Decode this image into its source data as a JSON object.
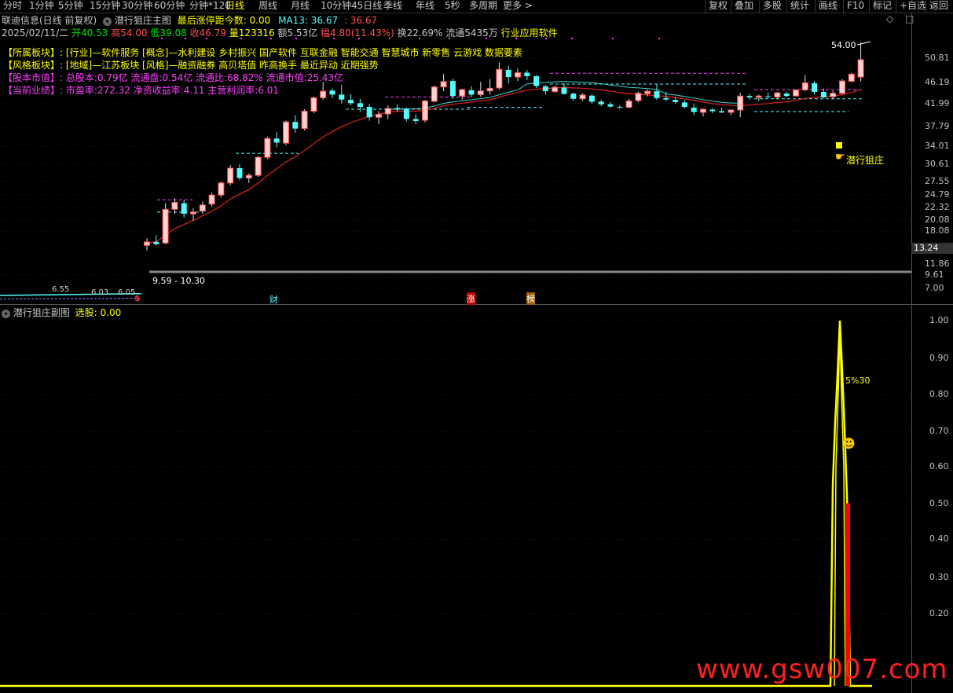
{
  "toolbar": {
    "periods": [
      "分时",
      "1分钟",
      "5分钟",
      "15分钟",
      "30分钟",
      "60分钟",
      "分钟*120",
      "日线",
      "周线",
      "月线",
      "10分钟",
      "45日线",
      "季线",
      "年线",
      "5秒",
      "多周期",
      "更多 >"
    ],
    "active_index": 7,
    "right_buttons": [
      "复权",
      "叠加",
      "多股",
      "统计",
      "画线",
      "F10",
      "标记",
      "+自选",
      "返回"
    ]
  },
  "stock": {
    "title": "联迪信息(日线 前复权)",
    "indicator": "潜行狙庄主图",
    "limit_text": "最后涨停距今数: 0.00",
    "ma13_label": "MA13: 36.67",
    "ma13_extra": ": 36.67"
  },
  "quote": {
    "date": "2025/02/11/二",
    "open": "开40.53",
    "high": "高54.00",
    "low": "低39.08",
    "close": "收46.79",
    "volume": "量123316",
    "amount": "额5.53亿",
    "change": "幅4.80(11.43%)",
    "turnover": "换22.69%",
    "float": "流通5435万",
    "industry": "行业应用软件"
  },
  "info": {
    "sector_label": "【所属板块】:",
    "sector_value": "[行业]—软件服务 [概念]—水利建设 乡村振兴 国产软件 互联金融 智能交通 智慧城市 新零售 云游戏 数据要素",
    "style_label": "【风格板块】:",
    "style_value": "[地域]—江苏板块 [风格]—融资融券 高贝塔值 昨高换手 最近异动 近期强势",
    "capital_label": "【股本市值】:",
    "capital_value": "总股本:0.79亿 流通盘:0.54亿 流通比:68.82% 流通市值:25.43亿",
    "perf_label": "【当前业绩】:",
    "perf_value": "市盈率:272.32 净资收益率:4.11 主营利润率:6.01"
  },
  "main_chart": {
    "y_ticks": [
      "50.81",
      "46.19",
      "41.99",
      "37.79",
      "34.01",
      "30.61",
      "27.55",
      "24.79",
      "22.32",
      "20.08",
      "18.08",
      "13.24",
      "11.86",
      "9.61",
      "7.00"
    ],
    "high_annotation": "54.00",
    "range_annotation": "9.59 - 10.30",
    "low_annotations": [
      "6.55",
      "6.03",
      "6.05"
    ],
    "signal_label": "潜行狙庄",
    "event_markers": [
      "$",
      "财",
      "涨",
      "榜"
    ],
    "current_price_box": "13.24"
  },
  "sub_chart": {
    "title": "潜行狙庄副图",
    "select_text": "选股: 0.00",
    "y_ticks": [
      "1.00",
      "0.90",
      "0.80",
      "0.70",
      "0.60",
      "0.50",
      "0.40",
      "0.30",
      "0.20"
    ],
    "peak_label": "5%30",
    "smiley": "☻"
  },
  "watermark": "www.gsw007.com",
  "colors": {
    "up": "#ff5050",
    "down": "#54fcfc",
    "ma": "#e02020",
    "ma2": "#40d0d0",
    "yellow": "#ffff00",
    "magenta": "#ff40ff",
    "bg": "#000000"
  },
  "chart_data": {
    "type": "candlestick",
    "candles": [
      [
        10.0,
        10.6,
        9.6,
        10.3
      ],
      [
        10.3,
        10.9,
        10.0,
        10.1
      ],
      [
        10.2,
        14.2,
        10.1,
        13.5
      ],
      [
        13.5,
        14.8,
        13.0,
        14.3
      ],
      [
        14.2,
        14.6,
        12.6,
        13.0
      ],
      [
        13.0,
        13.6,
        12.3,
        13.2
      ],
      [
        13.3,
        14.4,
        13.0,
        14.0
      ],
      [
        14.1,
        15.5,
        13.8,
        15.2
      ],
      [
        15.2,
        17.0,
        14.9,
        16.8
      ],
      [
        16.8,
        19.5,
        16.5,
        19.0
      ],
      [
        19.0,
        19.6,
        17.2,
        17.5
      ],
      [
        17.5,
        18.2,
        16.8,
        17.9
      ],
      [
        17.9,
        21.0,
        17.7,
        20.8
      ],
      [
        20.8,
        24.7,
        20.5,
        24.3
      ],
      [
        24.3,
        25.6,
        22.6,
        23.5
      ],
      [
        23.4,
        28.2,
        23.0,
        27.9
      ],
      [
        27.9,
        29.5,
        25.5,
        26.4
      ],
      [
        26.4,
        31.0,
        26.0,
        30.5
      ],
      [
        30.5,
        34.5,
        30.0,
        34.1
      ],
      [
        34.1,
        38.9,
        33.5,
        36.0
      ],
      [
        36.2,
        36.8,
        34.0,
        35.0
      ],
      [
        35.0,
        37.9,
        32.5,
        33.6
      ],
      [
        33.5,
        35.2,
        32.0,
        32.6
      ],
      [
        32.6,
        33.8,
        30.4,
        31.6
      ],
      [
        31.6,
        32.4,
        28.2,
        29.0
      ],
      [
        29.0,
        30.5,
        27.4,
        29.7
      ],
      [
        29.8,
        32.0,
        28.6,
        31.2
      ],
      [
        31.3,
        32.3,
        30.3,
        30.9
      ],
      [
        31.0,
        31.4,
        28.0,
        28.6
      ],
      [
        28.6,
        29.8,
        27.4,
        28.1
      ],
      [
        28.3,
        33.5,
        27.8,
        33.2
      ],
      [
        33.1,
        37.8,
        32.8,
        37.3
      ],
      [
        37.3,
        41.5,
        36.0,
        39.0
      ],
      [
        39.2,
        40.0,
        33.8,
        34.6
      ],
      [
        34.6,
        36.8,
        33.6,
        36.5
      ],
      [
        36.3,
        37.5,
        34.2,
        35.0
      ],
      [
        35.0,
        38.9,
        34.4,
        36.1
      ],
      [
        36.1,
        39.8,
        35.0,
        36.9
      ],
      [
        37.0,
        45.8,
        36.5,
        43.2
      ],
      [
        43.0,
        44.5,
        38.4,
        40.5
      ],
      [
        40.5,
        43.5,
        39.2,
        42.0
      ],
      [
        42.0,
        43.0,
        39.5,
        40.8
      ],
      [
        40.8,
        41.2,
        37.0,
        37.6
      ],
      [
        37.5,
        38.0,
        35.0,
        36.0
      ],
      [
        35.9,
        37.7,
        35.5,
        37.2
      ],
      [
        37.1,
        38.5,
        35.0,
        35.2
      ],
      [
        35.3,
        35.6,
        33.2,
        33.8
      ],
      [
        33.8,
        35.4,
        33.2,
        34.9
      ],
      [
        34.7,
        35.2,
        32.5,
        33.0
      ],
      [
        33.0,
        33.6,
        31.8,
        32.3
      ],
      [
        32.3,
        32.9,
        31.3,
        31.7
      ],
      [
        31.6,
        32.0,
        31.2,
        31.5
      ],
      [
        31.5,
        33.8,
        31.2,
        33.2
      ],
      [
        33.3,
        35.9,
        32.8,
        35.4
      ],
      [
        35.3,
        36.5,
        34.5,
        36.0
      ],
      [
        36.0,
        38.2,
        33.5,
        34.0
      ],
      [
        34.0,
        35.8,
        33.2,
        33.6
      ],
      [
        33.5,
        34.3,
        32.5,
        32.9
      ],
      [
        32.8,
        33.4,
        31.2,
        31.6
      ],
      [
        31.4,
        32.5,
        29.5,
        30.3
      ],
      [
        30.2,
        31.2,
        29.2,
        31.0
      ],
      [
        30.9,
        31.3,
        30.0,
        30.5
      ],
      [
        30.5,
        31.4,
        30.0,
        30.2
      ],
      [
        30.2,
        31.0,
        29.5,
        30.8
      ],
      [
        30.8,
        35.5,
        29.0,
        34.6
      ],
      [
        34.6,
        35.2,
        33.6,
        34.2
      ],
      [
        34.2,
        35.0,
        33.2,
        34.6
      ],
      [
        34.5,
        35.6,
        34.0,
        34.3
      ],
      [
        34.3,
        35.8,
        33.8,
        35.5
      ],
      [
        35.3,
        35.9,
        34.3,
        34.6
      ],
      [
        34.6,
        36.5,
        34.5,
        36.4
      ],
      [
        36.4,
        41.2,
        36.0,
        38.6
      ],
      [
        38.5,
        39.2,
        35.0,
        35.8
      ],
      [
        35.8,
        36.8,
        34.0,
        34.2
      ],
      [
        34.4,
        36.2,
        33.6,
        35.4
      ],
      [
        35.4,
        39.8,
        35.0,
        39.2
      ],
      [
        39.1,
        42.0,
        38.8,
        41.5
      ],
      [
        40.5,
        54.0,
        39.1,
        46.8
      ]
    ],
    "ma_values": [
      10.2,
      10.3,
      10.9,
      11.5,
      11.9,
      12.3,
      12.8,
      13.3,
      13.9,
      14.7,
      15.3,
      15.9,
      16.8,
      17.9,
      18.9,
      20.0,
      20.9,
      22.0,
      23.3,
      24.6,
      25.8,
      26.8,
      27.7,
      28.5,
      29.2,
      29.8,
      30.2,
      30.5,
      30.5,
      30.5,
      30.7,
      31.2,
      31.9,
      32.3,
      32.6,
      32.9,
      33.2,
      33.5,
      34.3,
      35.0,
      35.7,
      36.3,
      36.6,
      36.8,
      37.0,
      37.1,
      37.0,
      36.9,
      36.7,
      36.4,
      36.0,
      35.6,
      35.3,
      35.1,
      34.9,
      34.7,
      34.5,
      34.2,
      33.8,
      33.4,
      32.9,
      32.5,
      32.2,
      32.0,
      32.0,
      32.1,
      32.3,
      32.5,
      32.8,
      33.0,
      33.4,
      33.9,
      34.2,
      34.4,
      34.6,
      35.0,
      35.6,
      36.6
    ]
  }
}
